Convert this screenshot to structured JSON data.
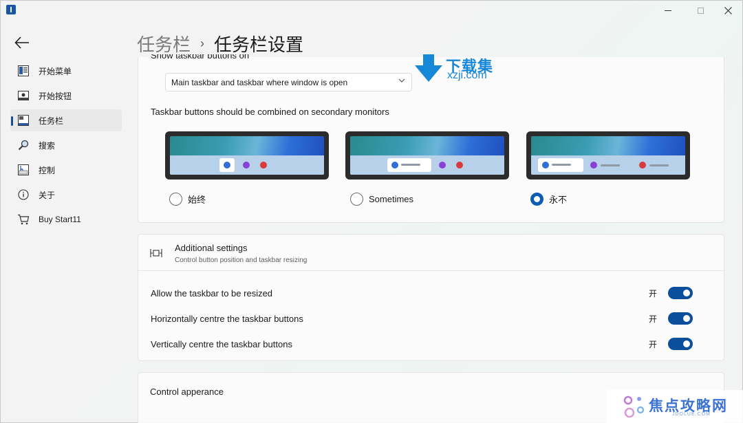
{
  "header": {
    "parent": "任务栏",
    "separator": "›",
    "current": "任务栏设置"
  },
  "sidebar": {
    "items": [
      {
        "label": "开始菜单",
        "icon": "start-menu-icon"
      },
      {
        "label": "开始按钮",
        "icon": "start-button-icon"
      },
      {
        "label": "任务栏",
        "icon": "taskbar-icon",
        "active": true
      },
      {
        "label": "搜索",
        "icon": "search-icon"
      },
      {
        "label": "控制",
        "icon": "control-icon"
      },
      {
        "label": "关于",
        "icon": "info-icon"
      },
      {
        "label": "Buy Start11",
        "icon": "cart-icon"
      }
    ]
  },
  "taskbar_buttons": {
    "cut_label": "Show taskbar buttons on",
    "dropdown_value": "Main taskbar and taskbar where window is open",
    "combine_label": "Taskbar buttons should be combined on secondary monitors",
    "options": [
      {
        "label": "始终",
        "checked": false
      },
      {
        "label": "Sometimes",
        "checked": false
      },
      {
        "label": "永不",
        "checked": true
      }
    ]
  },
  "additional": {
    "title": "Additional settings",
    "subtitle": "Control button position and taskbar resizing",
    "rows": [
      {
        "label": "Allow the taskbar to be resized",
        "state_text": "开",
        "on": true
      },
      {
        "label": "Horizontally centre the taskbar buttons",
        "state_text": "开",
        "on": true
      },
      {
        "label": "Vertically centre the taskbar buttons",
        "state_text": "开",
        "on": true
      }
    ]
  },
  "appearance": {
    "title": "Control apperance"
  },
  "watermarks": {
    "top_cn": "下载集",
    "top_url": "xzji.com",
    "bottom_cn": "焦点攻略网",
    "bottom_url": "JDOLUE.COM"
  },
  "colors": {
    "accent": "#0b4f9c",
    "radio_accent": "#0b5cb5"
  }
}
